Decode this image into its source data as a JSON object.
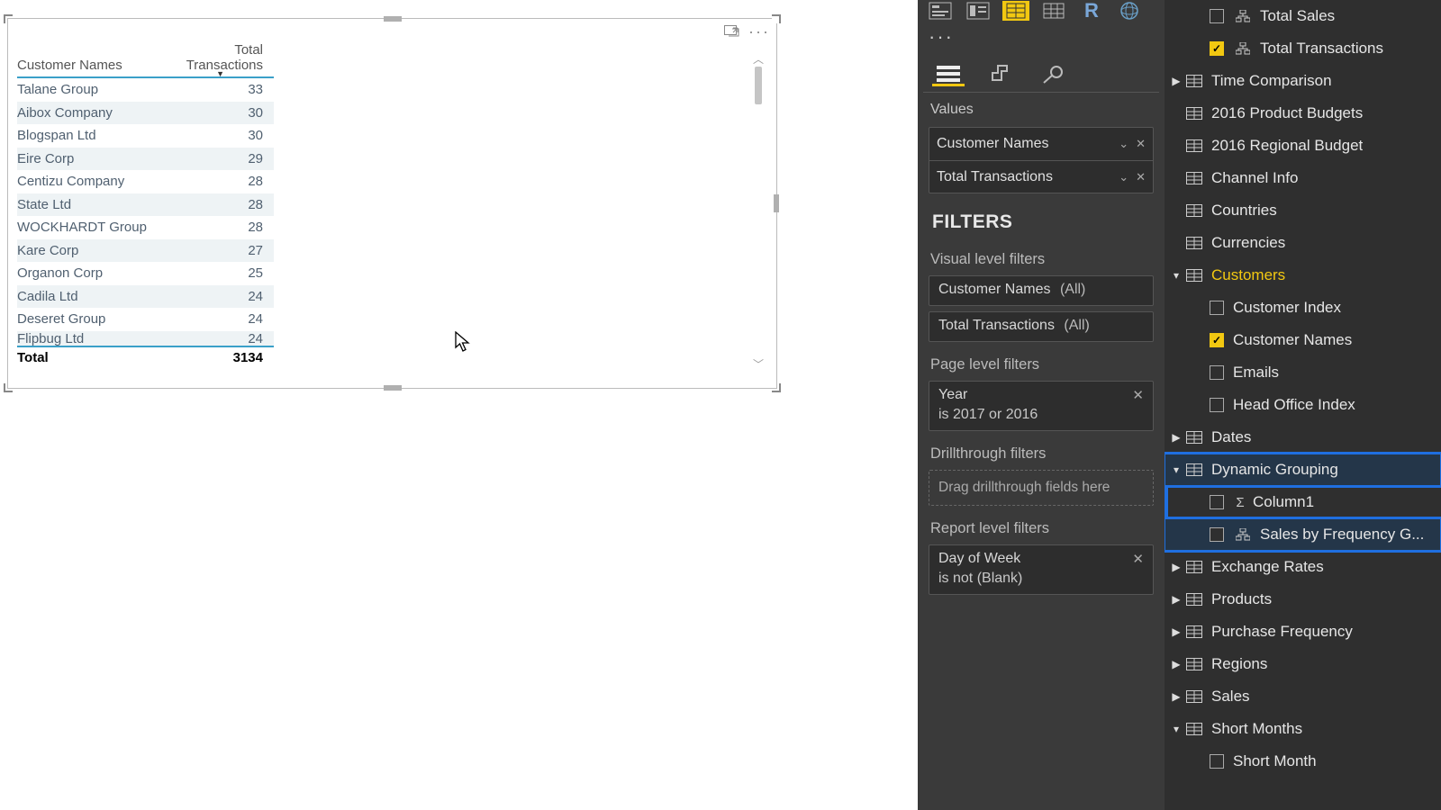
{
  "table": {
    "columns": [
      "Customer Names",
      "Total Transactions"
    ],
    "rows": [
      {
        "name": "Talane Group",
        "val": 33
      },
      {
        "name": "Aibox Company",
        "val": 30
      },
      {
        "name": "Blogspan Ltd",
        "val": 30
      },
      {
        "name": "Eire Corp",
        "val": 29
      },
      {
        "name": "Centizu Company",
        "val": 28
      },
      {
        "name": "State Ltd",
        "val": 28
      },
      {
        "name": "WOCKHARDT Group",
        "val": 28
      },
      {
        "name": "Kare Corp",
        "val": 27
      },
      {
        "name": "Organon Corp",
        "val": 25
      },
      {
        "name": "Cadila Ltd",
        "val": 24
      },
      {
        "name": "Deseret Group",
        "val": 24
      },
      {
        "name": "Flipbug Ltd",
        "val": 24
      }
    ],
    "total_label": "Total",
    "total_value": 3134
  },
  "viz": {
    "values_label": "Values",
    "value_fields": [
      "Customer Names",
      "Total Transactions"
    ],
    "filters_heading": "FILTERS",
    "visual_filters_label": "Visual level filters",
    "visual_filters": [
      {
        "name": "Customer Names",
        "scope": "(All)"
      },
      {
        "name": "Total Transactions",
        "scope": "(All)"
      }
    ],
    "page_filters_label": "Page level filters",
    "page_filter": {
      "name": "Year",
      "desc": "is 2017 or 2016"
    },
    "drill_label": "Drillthrough filters",
    "drill_placeholder": "Drag drillthrough fields here",
    "report_filters_label": "Report level filters",
    "report_filter": {
      "name": "Day of Week",
      "desc": "is not (Blank)"
    }
  },
  "fields": {
    "top_measures": [
      {
        "label": "Total Sales",
        "checked": false
      },
      {
        "label": "Total Transactions",
        "checked": true
      }
    ],
    "tables": [
      {
        "label": "Time Comparison",
        "expand": "right"
      },
      {
        "label": "2016 Product Budgets",
        "expand": "blank"
      },
      {
        "label": "2016 Regional Budget",
        "expand": "blank"
      },
      {
        "label": "Channel Info",
        "expand": "blank"
      },
      {
        "label": "Countries",
        "expand": "blank"
      },
      {
        "label": "Currencies",
        "expand": "blank"
      }
    ],
    "customers": {
      "label": "Customers",
      "cols": [
        {
          "label": "Customer Index",
          "checked": false
        },
        {
          "label": "Customer Names",
          "checked": true
        },
        {
          "label": "Emails",
          "checked": false
        },
        {
          "label": "Head Office Index",
          "checked": false
        }
      ]
    },
    "dates_label": "Dates",
    "dynamic": {
      "label": "Dynamic Grouping",
      "cols": [
        {
          "label": "Column1",
          "sigma": true
        },
        {
          "label": "Sales by Frequency G...",
          "hier": true,
          "hl": true
        }
      ]
    },
    "rest": [
      {
        "label": "Exchange Rates",
        "expand": "right"
      },
      {
        "label": "Products",
        "expand": "right"
      },
      {
        "label": "Purchase Frequency",
        "expand": "right"
      },
      {
        "label": "Regions",
        "expand": "right"
      },
      {
        "label": "Sales",
        "expand": "right"
      }
    ],
    "short_months": {
      "label": "Short Months",
      "col": "Short Month"
    }
  }
}
